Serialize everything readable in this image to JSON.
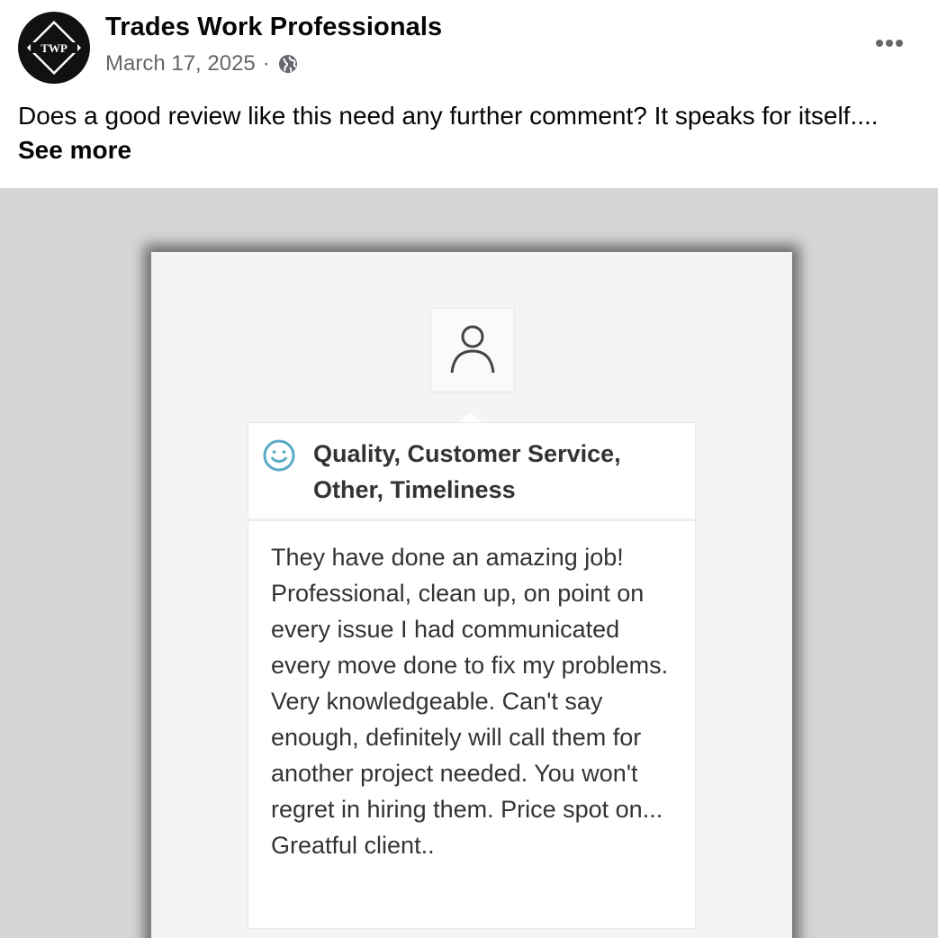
{
  "post": {
    "author": "Trades Work Professionals",
    "avatar_text": "TWP",
    "date": "March 17, 2025",
    "separator": "·",
    "privacy_icon": "globe-icon",
    "text": "Does a good review like this need any further comment? It speaks for itself....",
    "see_more_label": "See more",
    "more_icon": "ellipsis-icon"
  },
  "review": {
    "user_icon": "user-icon",
    "sentiment_icon": "smile-icon",
    "tags": "Quality, Customer Service, Other, Timeliness",
    "comment": "They have done an amazing job! Professional, clean up, on point on every issue I had communicated every move done to fix my problems. Very knowledgeable. Can't say enough, definitely will call them for another project needed. You won't regret in hiring them. Price spot on... Greatful client.."
  },
  "colors": {
    "text_primary": "#050505",
    "text_secondary": "#65676b",
    "smile_icon": "#5aa9c7",
    "image_background": "#d6d6d6"
  }
}
